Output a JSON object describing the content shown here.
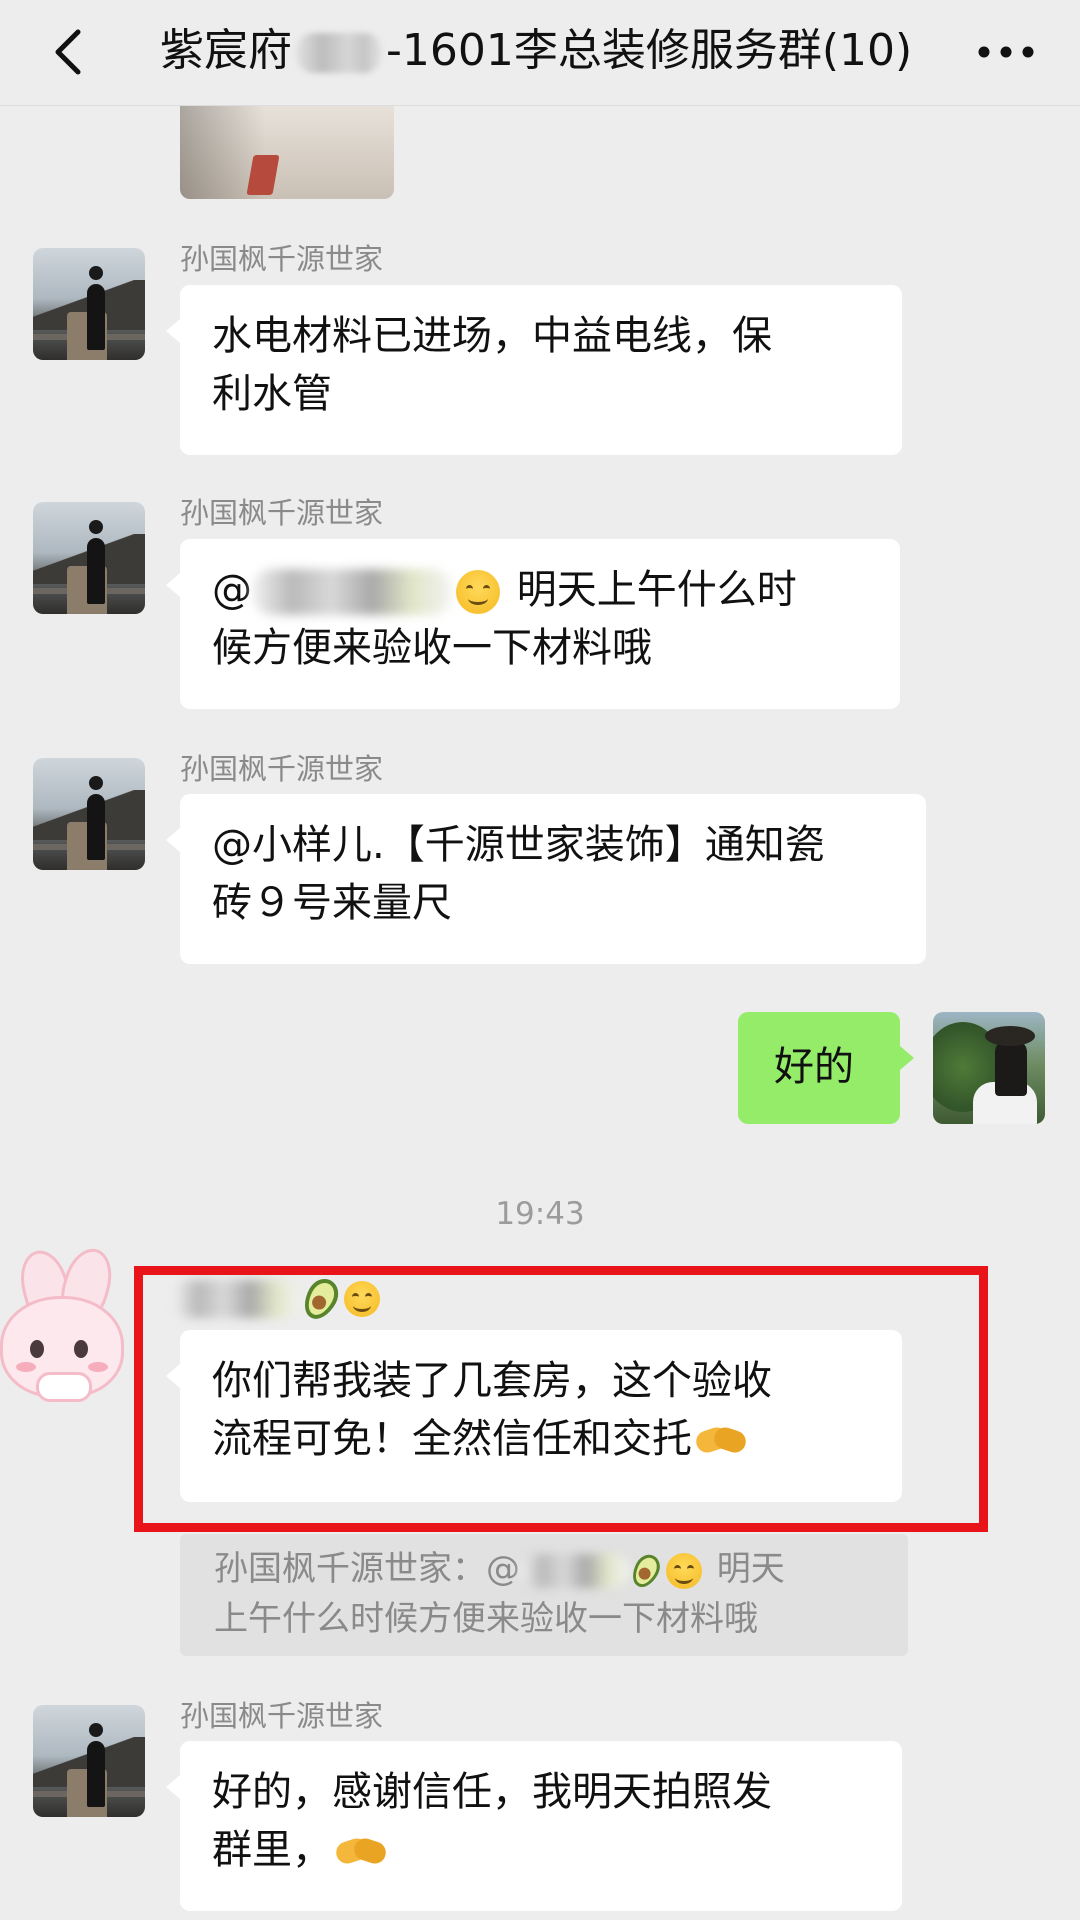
{
  "header": {
    "title_prefix": "紫宸府",
    "title_suffix": "-1601李总装修服务群(10)",
    "back_icon": "chevron-left-icon",
    "more_icon": "more-horizontal-icon"
  },
  "messages": [
    {
      "sender": "孙国枫千源世家",
      "lines": [
        "水电材料已进场，中益电线，保",
        "利水管"
      ]
    },
    {
      "sender": "孙国枫千源世家",
      "line1_prefix": "@",
      "line1_suffix": " 明天上午什么时",
      "line2": "候方便来验收一下材料哦"
    },
    {
      "sender": "孙国枫千源世家",
      "lines": [
        "@小样儿.【千源世家装饰】通知瓷",
        "砖９号来量尺"
      ]
    },
    {
      "self": true,
      "text": "好的"
    }
  ],
  "timestamp": "19:43",
  "highlighted_message": {
    "lines": [
      "你们帮我装了几套房，这个验收",
      "流程可免！全然信任和交托"
    ]
  },
  "quote": {
    "line1_prefix": "孙国枫千源世家：@",
    "line1_suffix": " 明天",
    "line2": "上午什么时候方便来验收一下材料哦"
  },
  "last_message": {
    "sender": "孙国枫千源世家",
    "lines": [
      "好的，感谢信任，我明天拍照发",
      "群里，"
    ]
  },
  "colors": {
    "background": "#ededed",
    "bubble_white": "#ffffff",
    "bubble_green": "#95ec69",
    "highlight_red": "#e8141a",
    "sender_gray": "#8a8a8a"
  }
}
